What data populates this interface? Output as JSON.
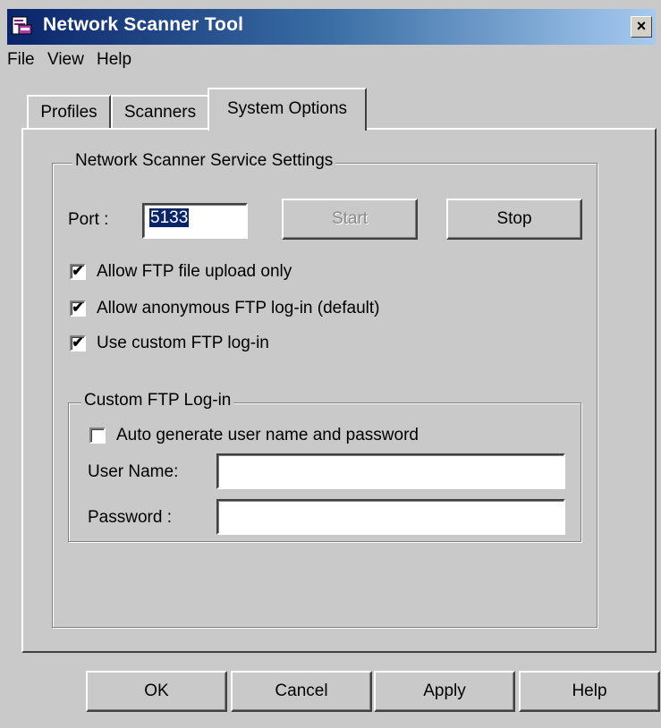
{
  "window": {
    "title": "Network Scanner Tool",
    "close_glyph": "×",
    "icon": "scanner-app-icon"
  },
  "menu": {
    "file": "File",
    "view": "View",
    "help": "Help"
  },
  "tabs": [
    {
      "label": "Profiles",
      "selected": false
    },
    {
      "label": "Scanners",
      "selected": false
    },
    {
      "label": "System Options",
      "selected": true
    }
  ],
  "service": {
    "group_title": "Network Scanner Service Settings",
    "port_label": "Port :",
    "port_value": "5133",
    "start_label": "Start",
    "start_enabled": false,
    "stop_label": "Stop",
    "options": [
      {
        "label": "Allow FTP file upload only",
        "checked": true
      },
      {
        "label": "Allow anonymous FTP log-in (default)",
        "checked": true
      },
      {
        "label": "Use custom FTP log-in",
        "checked": true
      }
    ]
  },
  "custom_login": {
    "group_title": "Custom FTP Log-in",
    "auto_generate_label": "Auto generate user name and password",
    "auto_generate_checked": false,
    "username_label": "User Name:",
    "username_value": "",
    "password_label": "Password :",
    "password_value": ""
  },
  "buttons": {
    "ok": "OK",
    "cancel": "Cancel",
    "apply": "Apply",
    "help": "Help"
  },
  "colors": {
    "titlebar_start": "#0a246a",
    "titlebar_end": "#a6caf0",
    "face": "#c9c9c9",
    "selection": "#0a246a"
  }
}
